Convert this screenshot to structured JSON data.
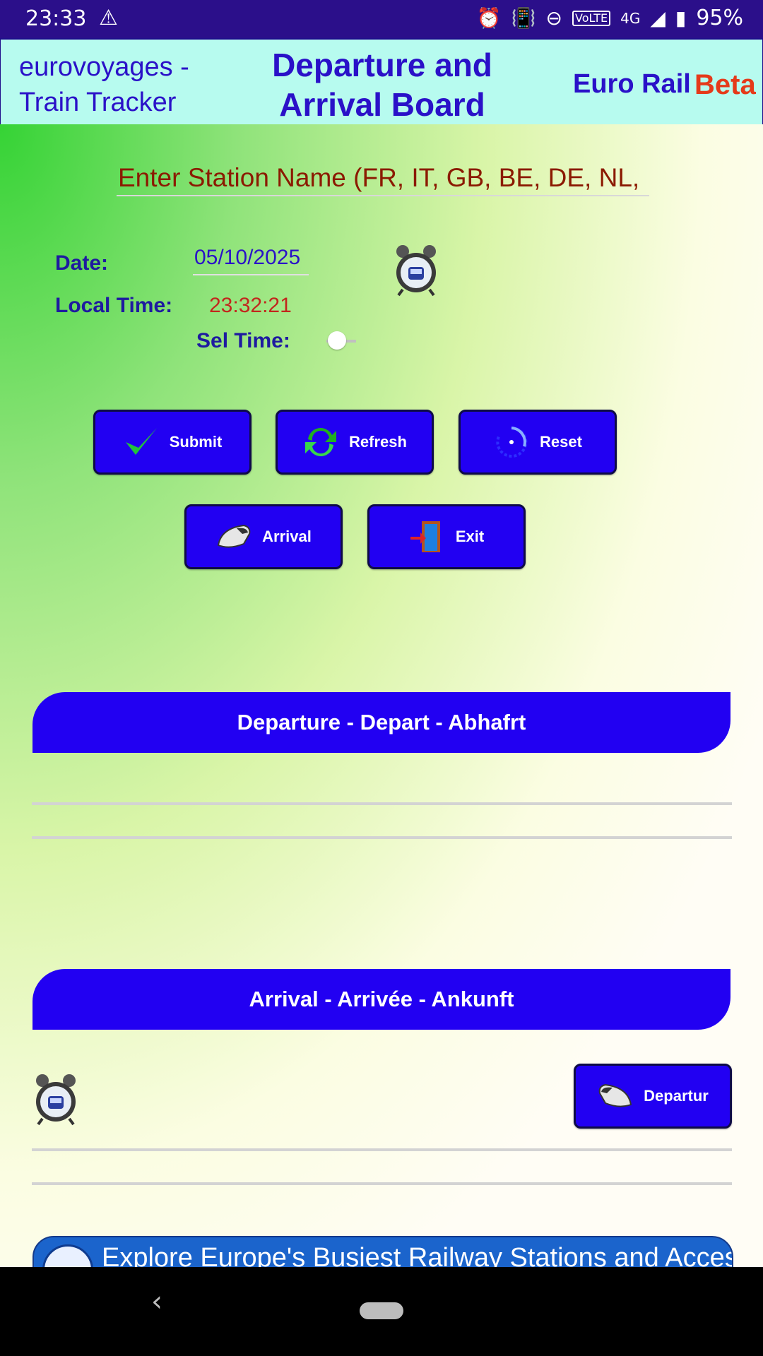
{
  "status_bar": {
    "time": "23:33",
    "battery": "95%",
    "network": "4G"
  },
  "header": {
    "brand": "eurovoyages - Train Tracker",
    "title": "Departure and Arrival Board",
    "euro_rail": "Euro Rail",
    "beta": "Beta"
  },
  "form": {
    "station_placeholder": "Enter Station Name (FR, IT, GB, BE, DE, NL, CH)",
    "date_label": "Date:",
    "date_value": "05/10/2025",
    "local_time_label": "Local Time:",
    "local_time_value": "23:32:21",
    "sel_time_label": "Sel Time:"
  },
  "buttons": {
    "submit": "Submit",
    "refresh": "Refresh",
    "reset": "Reset",
    "arrival": "Arrival",
    "exit": "Exit",
    "departure": "Departur"
  },
  "sections": {
    "departure": "Departure - Depart - Abhafrt",
    "arrival": "Arrival - Arrivée - Ankunft"
  },
  "banner": {
    "text": "Explore Europe's Busiest Railway Stations and Access"
  },
  "colors": {
    "accent": "#2200f2",
    "header_bg": "#b7fbef",
    "beta": "#e53a1a"
  }
}
